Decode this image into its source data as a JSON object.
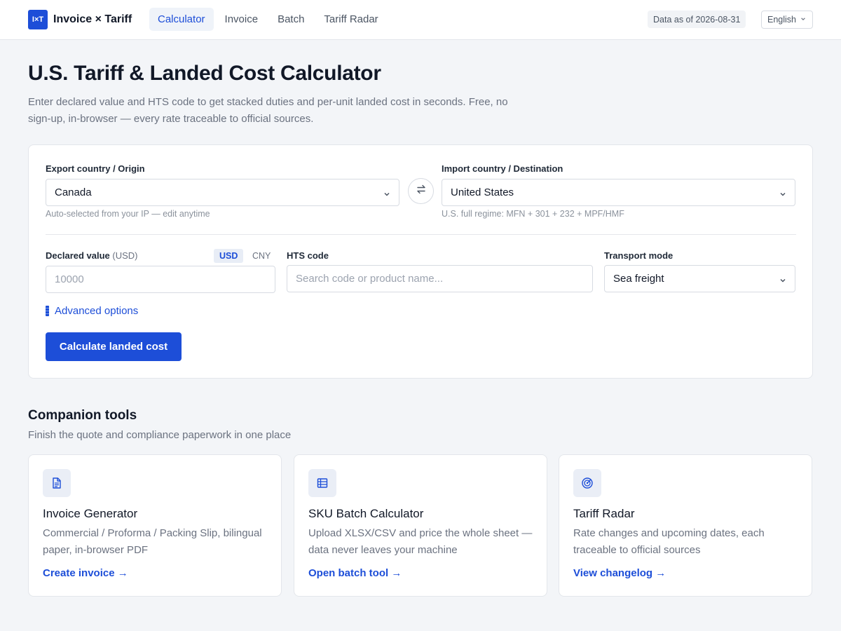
{
  "header": {
    "logo_mark": "I×T",
    "app_name": "Invoice × Tariff",
    "nav": [
      {
        "label": "Calculator",
        "active": true
      },
      {
        "label": "Invoice",
        "active": false
      },
      {
        "label": "Batch",
        "active": false
      },
      {
        "label": "Tariff Radar",
        "active": false
      }
    ],
    "data_as_of": "Data as of 2026-08-31",
    "language": "English"
  },
  "hero": {
    "title": "U.S. Tariff & Landed Cost Calculator",
    "subtitle": "Enter declared value and HTS code to get stacked duties and per-unit landed cost in seconds. Free, no sign-up, in-browser — every rate traceable to official sources."
  },
  "form": {
    "origin": {
      "label": "Export country / Origin",
      "value": "Canada",
      "hint": "Auto-selected from your IP — edit anytime"
    },
    "destination": {
      "label": "Import country / Destination",
      "value": "United States",
      "hint": "U.S. full regime: MFN + 301 + 232 + MPF/HMF"
    },
    "declared_value": {
      "label": "Declared value",
      "unit": "(USD)",
      "placeholder": "10000",
      "currencies": [
        "USD",
        "CNY"
      ],
      "selected_currency": "USD"
    },
    "hts": {
      "label": "HTS code",
      "placeholder": "Search code or product name..."
    },
    "transport": {
      "label": "Transport mode",
      "value": "Sea freight"
    },
    "advanced_label": "Advanced options",
    "submit_label": "Calculate landed cost"
  },
  "companion": {
    "title": "Companion tools",
    "subtitle": "Finish the quote and compliance paperwork in one place",
    "tools": [
      {
        "icon": "document-icon",
        "title": "Invoice Generator",
        "desc": "Commercial / Proforma / Packing Slip, bilingual paper, in-browser PDF",
        "link": "Create invoice →"
      },
      {
        "icon": "table-icon",
        "title": "SKU Batch Calculator",
        "desc": "Upload XLSX/CSV and price the whole sheet — data never leaves your machine",
        "link": "Open batch tool →"
      },
      {
        "icon": "radar-icon",
        "title": "Tariff Radar",
        "desc": "Rate changes and upcoming dates, each traceable to official sources",
        "link": "View changelog →"
      }
    ]
  },
  "colors": {
    "accent": "#1d4ed8",
    "background": "#f3f5f8",
    "muted_text": "#6b7280"
  }
}
